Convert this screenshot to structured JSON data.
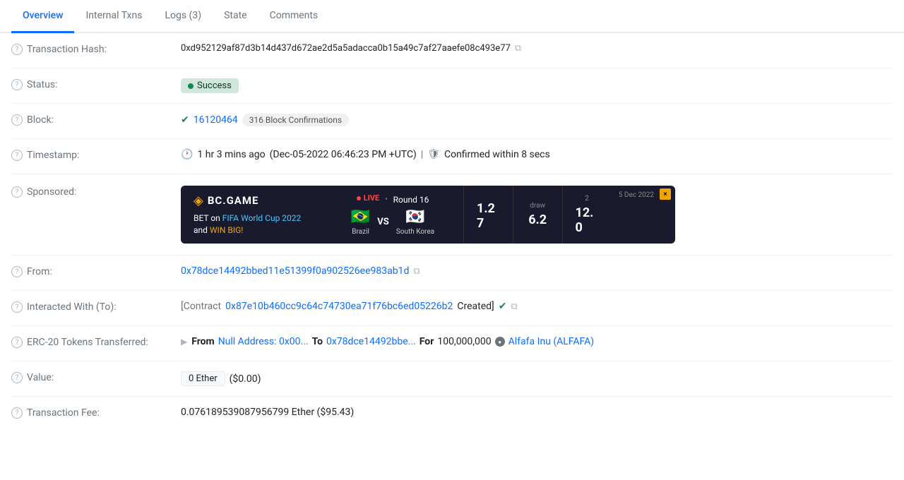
{
  "tabs": [
    {
      "id": "overview",
      "label": "Overview",
      "active": true
    },
    {
      "id": "internal-txns",
      "label": "Internal Txns",
      "active": false
    },
    {
      "id": "logs",
      "label": "Logs (3)",
      "active": false
    },
    {
      "id": "state",
      "label": "State",
      "active": false
    },
    {
      "id": "comments",
      "label": "Comments",
      "active": false
    }
  ],
  "fields": {
    "transaction_hash": {
      "label": "Transaction Hash:",
      "value": "0xd952129af87d3b14d437d672ae2d5a5adacca0b15a49c7af27aaefe08c493e77"
    },
    "status": {
      "label": "Status:",
      "value": "Success"
    },
    "block": {
      "label": "Block:",
      "number": "16120464",
      "confirmations": "316 Block Confirmations"
    },
    "timestamp": {
      "label": "Timestamp:",
      "time_ago": "1 hr 3 mins ago",
      "datetime": "(Dec-05-2022 06:46:23 PM +UTC)",
      "confirmed": "Confirmed within 8 secs"
    },
    "sponsored": {
      "label": "Sponsored:",
      "ad": {
        "logo": "BC.GAME",
        "tagline_prefix": "BET on ",
        "tagline_highlight": "FIFA World Cup 2022",
        "tagline_suffix": " and ",
        "tagline_win": "WIN BIG!",
        "live_label": "LIVE",
        "round": "Round 16",
        "team1_flag": "🇧🇷",
        "team1_name": "Brazil",
        "team2_flag": "🇰🇷",
        "team2_name": "South Korea",
        "vs": "VS",
        "date": "5 Dec 2022",
        "odd1": "1.27",
        "odd1_label": "",
        "odd2_label": "draw",
        "odd2": "6.2",
        "odd3_label": "2",
        "odd3": "12.0",
        "close": "×"
      }
    },
    "from": {
      "label": "From:",
      "value": "0x78dce14492bbed11e51399f0a902526ee983ab1d"
    },
    "interacted_with": {
      "label": "Interacted With (To):",
      "prefix": "[Contract ",
      "contract": "0x87e10b460cc9c64c74730ea71f76bc6ed05226b2",
      "suffix": " Created]"
    },
    "erc20_tokens": {
      "label": "ERC-20 Tokens Transferred:",
      "from_label": "From",
      "from_address": "Null Address: 0x00...",
      "to_label": "To",
      "to_address": "0x78dce14492bbe...",
      "for_label": "For",
      "amount": "100,000,000",
      "token_icon": "●",
      "token_name": "Alfafa Inu (ALFAFA)"
    },
    "value": {
      "label": "Value:",
      "eth_value": "0 Ether",
      "usd_value": "($0.00)"
    },
    "transaction_fee": {
      "label": "Transaction Fee:",
      "value": "0.076189539087956799 Ether ($95.43)"
    }
  }
}
